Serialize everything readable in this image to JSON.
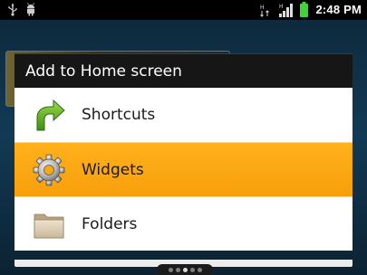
{
  "status_bar": {
    "left_icons": [
      "usb-icon",
      "android-debug-icon"
    ],
    "right_icons": [
      "network-sync-icon",
      "signal-icon",
      "battery-icon"
    ],
    "time": "2:48 PM"
  },
  "dialog": {
    "title": "Add to Home screen",
    "items": [
      {
        "label": "Shortcuts",
        "icon": "shortcut-arrow-icon",
        "selected": false
      },
      {
        "label": "Widgets",
        "icon": "gear-widget-icon",
        "selected": true
      },
      {
        "label": "Folders",
        "icon": "folder-icon",
        "selected": false
      }
    ]
  },
  "colors": {
    "selection": "#ffa812",
    "title_bar": "#161616",
    "list_bg": "#ffffff",
    "battery": "#3fd43a"
  },
  "home_screen": {
    "page_count": 5,
    "active_page": 3
  }
}
